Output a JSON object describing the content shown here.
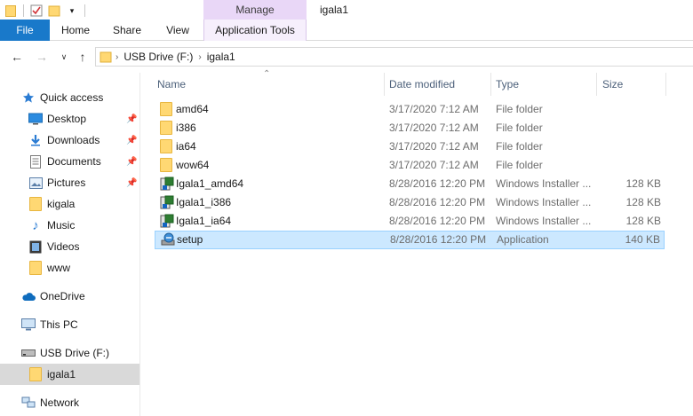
{
  "window": {
    "title": "igala1"
  },
  "ribbon": {
    "context_group": "Manage",
    "tabs": [
      "File",
      "Home",
      "Share",
      "View",
      "Application Tools"
    ]
  },
  "address": {
    "crumbs": [
      "USB Drive (F:)",
      "igala1"
    ]
  },
  "nav": {
    "quick_access": "Quick access",
    "quick_items": [
      {
        "label": "Desktop",
        "icon": "desktop-icon",
        "pinned": true
      },
      {
        "label": "Downloads",
        "icon": "downloads-icon",
        "pinned": true
      },
      {
        "label": "Documents",
        "icon": "documents-icon",
        "pinned": true
      },
      {
        "label": "Pictures",
        "icon": "pictures-icon",
        "pinned": true
      },
      {
        "label": "kigala",
        "icon": "folder-icon",
        "pinned": false
      },
      {
        "label": "Music",
        "icon": "music-icon",
        "pinned": false
      },
      {
        "label": "Videos",
        "icon": "videos-icon",
        "pinned": false
      },
      {
        "label": "www",
        "icon": "folder-icon",
        "pinned": false
      }
    ],
    "onedrive": "OneDrive",
    "thispc": "This PC",
    "usb": "USB Drive (F:)",
    "usb_child": "igala1",
    "network": "Network"
  },
  "columns": {
    "name": "Name",
    "date": "Date modified",
    "type": "Type",
    "size": "Size"
  },
  "files": [
    {
      "name": "amd64",
      "date": "3/17/2020 7:12 AM",
      "type": "File folder",
      "size": "",
      "icon": "folder-icon"
    },
    {
      "name": "i386",
      "date": "3/17/2020 7:12 AM",
      "type": "File folder",
      "size": "",
      "icon": "folder-icon"
    },
    {
      "name": "ia64",
      "date": "3/17/2020 7:12 AM",
      "type": "File folder",
      "size": "",
      "icon": "folder-icon"
    },
    {
      "name": "wow64",
      "date": "3/17/2020 7:12 AM",
      "type": "File folder",
      "size": "",
      "icon": "folder-icon"
    },
    {
      "name": "Igala1_amd64",
      "date": "8/28/2016 12:20 PM",
      "type": "Windows Installer ...",
      "size": "128 KB",
      "icon": "msi-icon"
    },
    {
      "name": "Igala1_i386",
      "date": "8/28/2016 12:20 PM",
      "type": "Windows Installer ...",
      "size": "128 KB",
      "icon": "msi-icon"
    },
    {
      "name": "Igala1_ia64",
      "date": "8/28/2016 12:20 PM",
      "type": "Windows Installer ...",
      "size": "128 KB",
      "icon": "msi-icon"
    },
    {
      "name": "setup",
      "date": "8/28/2016 12:20 PM",
      "type": "Application",
      "size": "140 KB",
      "icon": "setup-icon",
      "selected": true
    }
  ]
}
